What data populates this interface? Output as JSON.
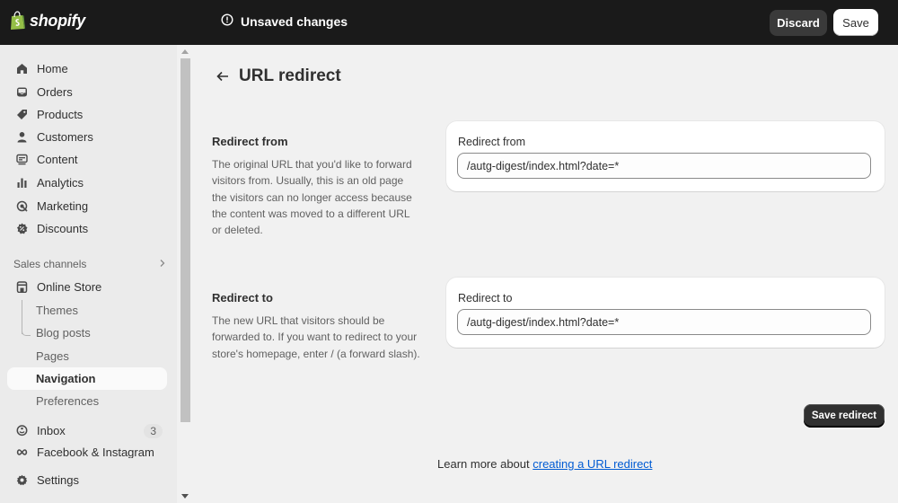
{
  "topbar": {
    "logo_text": "shopify",
    "status_text": "Unsaved changes",
    "discard_label": "Discard",
    "save_label": "Save"
  },
  "sidebar": {
    "items": [
      {
        "label": "Home",
        "icon": "home-icon"
      },
      {
        "label": "Orders",
        "icon": "inbox-tray-icon"
      },
      {
        "label": "Products",
        "icon": "tag-icon"
      },
      {
        "label": "Customers",
        "icon": "person-icon"
      },
      {
        "label": "Content",
        "icon": "content-icon"
      },
      {
        "label": "Analytics",
        "icon": "bar-chart-icon"
      },
      {
        "label": "Marketing",
        "icon": "target-icon"
      },
      {
        "label": "Discounts",
        "icon": "discount-badge-icon"
      }
    ],
    "sales_channels_label": "Sales channels",
    "online_store_label": "Online Store",
    "sub_items": [
      "Themes",
      "Blog posts",
      "Pages",
      "Navigation",
      "Preferences"
    ],
    "active_sub_item": "Navigation",
    "inbox_label": "Inbox",
    "inbox_count": "3",
    "facebook_label": "Facebook & Instagram",
    "settings_label": "Settings"
  },
  "main": {
    "page_title": "URL redirect",
    "redirect_from": {
      "title": "Redirect from",
      "description": "The original URL that you'd like to forward visitors from. Usually, this is an old page the visitors can no longer access because the content was moved to a different URL or deleted.",
      "field_label": "Redirect from",
      "value": "/autg-digest/index.html?date=*"
    },
    "redirect_to": {
      "title": "Redirect to",
      "description": "The new URL that visitors should be forwarded to. If you want to redirect to your store's homepage, enter / (a forward slash).",
      "field_label": "Redirect to",
      "value": "/autg-digest/index.html?date=*"
    },
    "save_redirect_label": "Save redirect",
    "learn_more_prefix": "Learn more about ",
    "learn_more_link": "creating a URL redirect"
  },
  "colors": {
    "topbar_bg": "#1a1a1a",
    "sidebar_bg": "#ebebeb",
    "page_bg": "#f1f1f1",
    "link": "#005bd3",
    "primary_button": "#303030"
  }
}
